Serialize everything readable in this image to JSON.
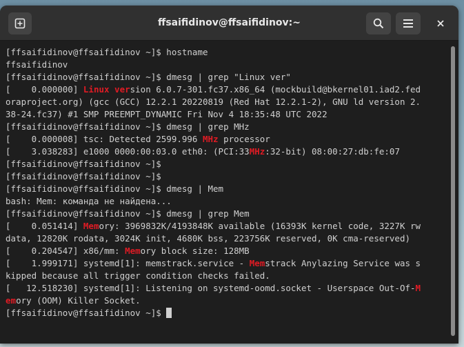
{
  "window": {
    "title": "ffsaifidinov@ffsaifidinov:~"
  },
  "icons": {
    "new_tab": "new-tab-icon",
    "search": "search-icon",
    "menu": "hamburger-menu-icon",
    "close": "close-icon"
  },
  "colors": {
    "highlight": "#e01b24",
    "terminal_bg": "#1e1e1e",
    "text": "#d0d0d0"
  },
  "terminal": {
    "lines": [
      [
        {
          "t": "[ffsaifidinov@ffsaifidinov ~]$ hostname"
        }
      ],
      [
        {
          "t": "ffsaifidinov"
        }
      ],
      [
        {
          "t": "[ffsaifidinov@ffsaifidinov ~]$ dmesg | grep \"Linux ver\""
        }
      ],
      [
        {
          "t": "[    0.000000] "
        },
        {
          "t": "Linux ver",
          "hl": true
        },
        {
          "t": "sion 6.0.7-301.fc37.x86_64 (mockbuild@bkernel01.iad2.fed"
        }
      ],
      [
        {
          "t": "oraproject.org) (gcc (GCC) 12.2.1 20220819 (Red Hat 12.2.1-2), GNU ld version 2."
        }
      ],
      [
        {
          "t": "38-24.fc37) #1 SMP PREEMPT_DYNAMIC Fri Nov 4 18:35:48 UTC 2022"
        }
      ],
      [
        {
          "t": "[ffsaifidinov@ffsaifidinov ~]$ dmesg | grep MHz"
        }
      ],
      [
        {
          "t": "[    0.000008] tsc: Detected 2599.996 "
        },
        {
          "t": "MHz",
          "hl": true
        },
        {
          "t": " processor"
        }
      ],
      [
        {
          "t": "[    3.038283] e1000 0000:00:03.0 eth0: (PCI:33"
        },
        {
          "t": "MHz",
          "hl": true
        },
        {
          "t": ":32-bit) 08:00:27:db:fe:07"
        }
      ],
      [
        {
          "t": "[ffsaifidinov@ffsaifidinov ~]$"
        }
      ],
      [
        {
          "t": "[ffsaifidinov@ffsaifidinov ~]$"
        }
      ],
      [
        {
          "t": "[ffsaifidinov@ffsaifidinov ~]$ dmesg | Mem"
        }
      ],
      [
        {
          "t": "bash: Mem: команда не найдена..."
        }
      ],
      [
        {
          "t": "[ffsaifidinov@ffsaifidinov ~]$ dmesg | grep Mem"
        }
      ],
      [
        {
          "t": "[    0.051414] "
        },
        {
          "t": "Mem",
          "hl": true
        },
        {
          "t": "ory: 3969832K/4193848K available (16393K kernel code, 3227K rw"
        }
      ],
      [
        {
          "t": "data, 12820K rodata, 3024K init, 4680K bss, 223756K reserved, 0K cma-reserved)"
        }
      ],
      [
        {
          "t": "[    0.204547] x86/mm: "
        },
        {
          "t": "Mem",
          "hl": true
        },
        {
          "t": "ory block size: 128MB"
        }
      ],
      [
        {
          "t": "[    1.999171] systemd[1]: memstrack.service - "
        },
        {
          "t": "Mem",
          "hl": true
        },
        {
          "t": "strack Anylazing Service was s"
        }
      ],
      [
        {
          "t": "kipped because all trigger condition checks failed."
        }
      ],
      [
        {
          "t": "[   12.518230] systemd[1]: Listening on systemd-oomd.socket - Userspace Out-Of-"
        },
        {
          "t": "M",
          "hl": true
        }
      ],
      [
        {
          "t": "em",
          "hl": true
        },
        {
          "t": "ory (OOM) Killer Socket."
        }
      ],
      [
        {
          "t": "[ffsaifidinov@ffsaifidinov ~]$ "
        }
      ]
    ]
  }
}
